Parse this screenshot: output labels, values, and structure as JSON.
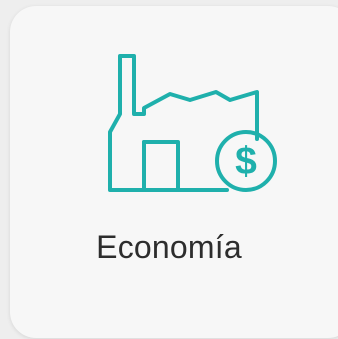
{
  "card": {
    "title": "Economía",
    "icon": "factory-dollar-icon"
  },
  "colors": {
    "card_background": "#f7f7f7",
    "page_background": "#eeeeee",
    "icon_stroke": "#1fb0ac",
    "title_text": "#2d2d2d"
  }
}
